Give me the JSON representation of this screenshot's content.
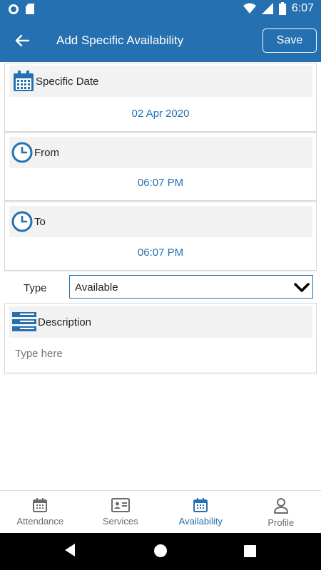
{
  "status_bar": {
    "time": "6:07"
  },
  "app_bar": {
    "title": "Add Specific Availability",
    "save_label": "Save"
  },
  "specific_date": {
    "label": "Specific Date",
    "value": "02 Apr 2020",
    "icon": "calendar-icon"
  },
  "from": {
    "label": "From",
    "value": "06:07 PM",
    "icon": "clock-icon"
  },
  "to": {
    "label": "To",
    "value": "06:07 PM",
    "icon": "clock-icon"
  },
  "type": {
    "label": "Type",
    "selected": "Available"
  },
  "description": {
    "label": "Description",
    "placeholder": "Type here",
    "icon": "list-icon"
  },
  "bottom_nav": {
    "items": [
      {
        "label": "Attendance",
        "icon": "calendar-icon",
        "active": false
      },
      {
        "label": "Services",
        "icon": "id-card-icon",
        "active": false
      },
      {
        "label": "Availability",
        "icon": "calendar-icon",
        "active": true
      },
      {
        "label": "Profile",
        "icon": "person-icon",
        "active": false
      }
    ]
  },
  "colors": {
    "primary": "#2470b0",
    "header_bg": "#f2f2f2",
    "inactive": "#6b6b6b"
  }
}
